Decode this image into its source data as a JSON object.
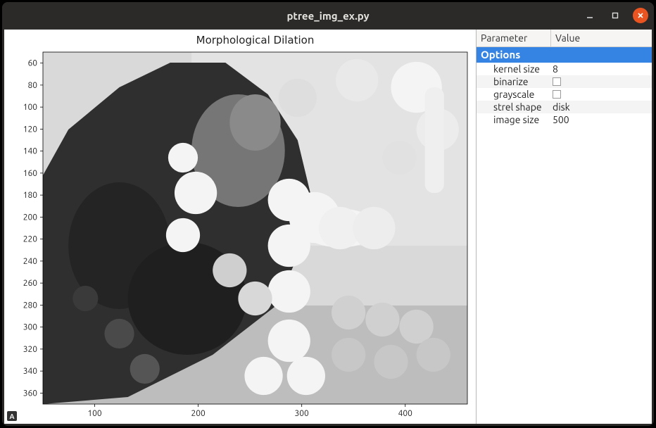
{
  "window": {
    "title": "ptree_img_ex.py"
  },
  "chart_data": {
    "type": "image",
    "title": "Morphological Dilation",
    "xlabel": "",
    "ylabel": "",
    "xticks": [
      100,
      200,
      300,
      400
    ],
    "yticks": [
      60,
      80,
      100,
      120,
      140,
      160,
      180,
      200,
      220,
      240,
      260,
      280,
      300,
      320,
      340,
      360
    ],
    "xlim": [
      50,
      460
    ],
    "ylim": [
      50,
      370
    ]
  },
  "panel": {
    "headers": {
      "param": "Parameter",
      "value": "Value"
    },
    "group": "Options",
    "rows": [
      {
        "name": "kernel size",
        "value": "8",
        "type": "text"
      },
      {
        "name": "binarize",
        "value": false,
        "type": "bool"
      },
      {
        "name": "grayscale",
        "value": false,
        "type": "bool"
      },
      {
        "name": "strel shape",
        "value": "disk",
        "type": "text"
      },
      {
        "name": "image size",
        "value": "500",
        "type": "text"
      }
    ]
  },
  "badge": "A"
}
